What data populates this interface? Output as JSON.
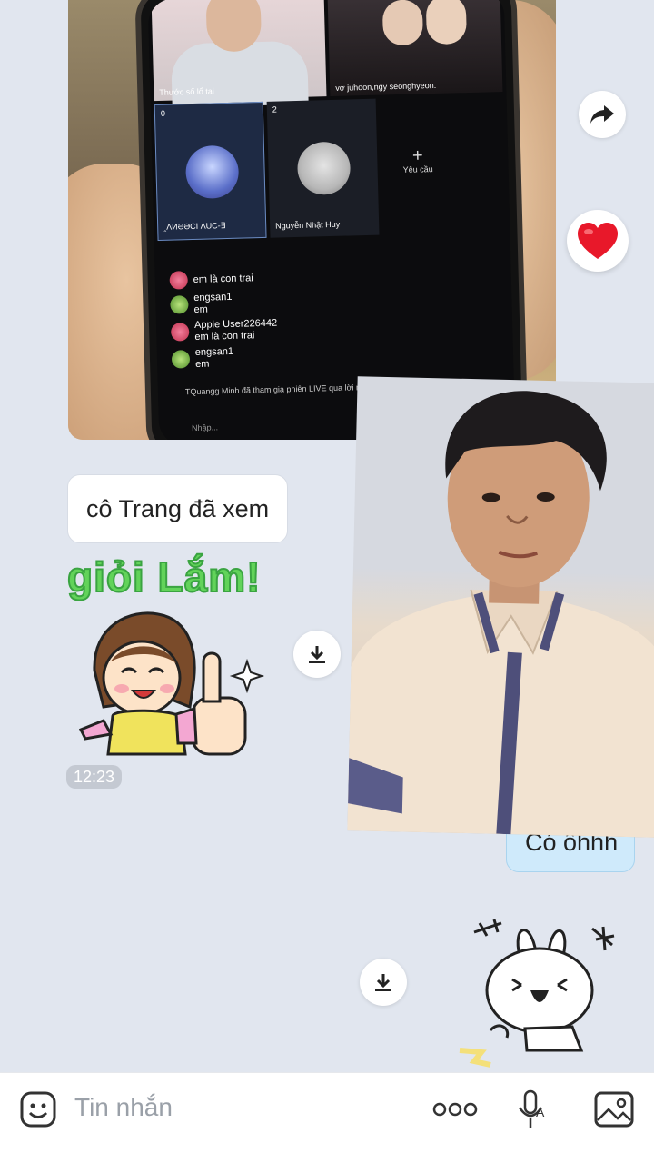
{
  "photo_message": {
    "cam_captions": [
      "Thước số lổ tai",
      "vợ juhoon,ngy seonghyeon."
    ],
    "seats": [
      {
        "count": "0",
        "name": "ꞈΛИƏƏCI ɅUC-∃"
      },
      {
        "count": "2",
        "name": "Nguyễn Nhật Huy"
      }
    ],
    "request_label": "Yêu cầu",
    "chat_lines": [
      {
        "user": "",
        "text": "em là con trai"
      },
      {
        "user": "engsan1",
        "text": "em"
      },
      {
        "user": "Apple User226442",
        "text": "em là con trai"
      },
      {
        "user": "engsan1",
        "text": "em"
      }
    ],
    "system_line": "TQuangg Minh đã tham gia phiên LIVE qua lời mời chia sẻ",
    "input_placeholder": "Nhập..."
  },
  "received_message": {
    "text": "cô Trang đã xem",
    "sticker_text": "giỏi Lắm!",
    "time": "12:23"
  },
  "sent_message": {
    "text": "Có ồhhh"
  },
  "composer": {
    "placeholder": "Tin nhắn"
  },
  "colors": {
    "background": "#e1e6ef",
    "sent_bubble": "#cfeafb",
    "received_bubble": "#ffffff",
    "sticker_green": "#62d35a",
    "heart_red": "#e8182a"
  },
  "icons": [
    "forward-icon",
    "heart-icon",
    "download-icon",
    "emoji-icon",
    "more-icon",
    "voice-icon",
    "image-icon"
  ]
}
